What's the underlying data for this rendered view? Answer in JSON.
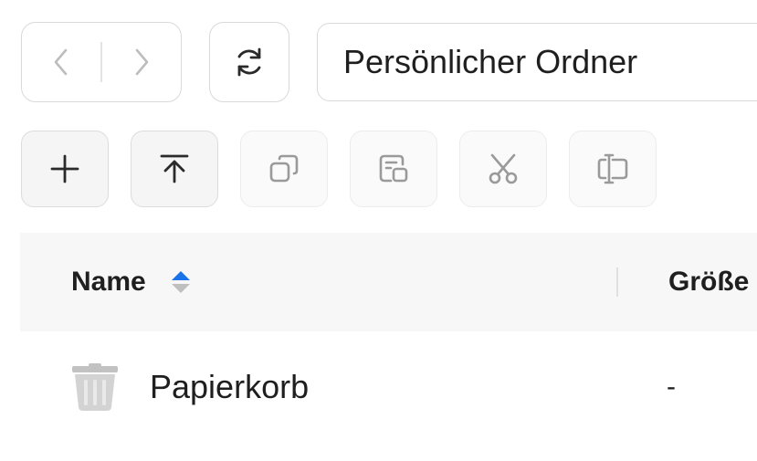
{
  "navigation": {
    "back_icon": "chevron-left-icon",
    "forward_icon": "chevron-right-icon",
    "refresh_icon": "refresh-icon"
  },
  "path": {
    "value": "Persönlicher Ordner"
  },
  "toolbar": {
    "items": [
      {
        "icon": "plus-icon",
        "enabled": true
      },
      {
        "icon": "upload-icon",
        "enabled": true
      },
      {
        "icon": "copy-icon",
        "enabled": false
      },
      {
        "icon": "move-icon",
        "enabled": false
      },
      {
        "icon": "cut-icon",
        "enabled": false
      },
      {
        "icon": "rename-icon",
        "enabled": false
      }
    ]
  },
  "table": {
    "columns": {
      "name": "Name",
      "size": "Größe"
    },
    "sort": {
      "column": "name",
      "direction": "ascending",
      "active_color": "#1a73e8"
    },
    "rows": [
      {
        "name": "Papierkorb",
        "size": "-",
        "icon": "trash-icon"
      }
    ]
  }
}
